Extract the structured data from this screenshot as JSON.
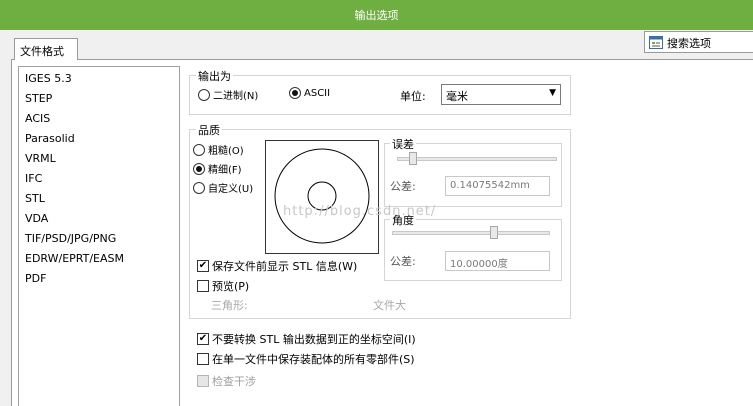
{
  "window": {
    "title": "输出选项"
  },
  "tab": {
    "label": "文件格式"
  },
  "search": {
    "label": "搜索选项",
    "icon": "search-options-icon"
  },
  "formats": [
    "IGES 5.3",
    "STEP",
    "ACIS",
    "Parasolid",
    "VRML",
    "IFC",
    "STL",
    "VDA",
    "TIF/PSD/JPG/PNG",
    "EDRW/EPRT/EASM",
    "PDF"
  ],
  "output_as": {
    "title": "输出为",
    "binary": {
      "label": "二进制(N)",
      "selected": false
    },
    "ascii": {
      "label": "ASCII",
      "selected": true
    },
    "unit_label": "单位:",
    "unit_value": "毫米"
  },
  "quality": {
    "title": "品质",
    "coarse": {
      "label": "粗糙(O)",
      "selected": false
    },
    "fine": {
      "label": "精细(F)",
      "selected": true
    },
    "custom": {
      "label": "自定义(U)",
      "selected": false
    }
  },
  "deviation": {
    "title": "误差",
    "tolerance_label": "公差:",
    "tolerance_value": "0.14075542mm",
    "slider_level": 0.08
  },
  "angle": {
    "title": "角度",
    "tolerance_label": "公差:",
    "tolerance_value": "10.00000度",
    "slider_level": 0.65
  },
  "show_stl_info": {
    "label": "保存文件前显示 STL 信息(W)",
    "checked": true
  },
  "preview": {
    "label": "预览(P)",
    "checked": false
  },
  "triangles_label": "三角形:",
  "file_size_label": "文件大",
  "no_translate": {
    "label": "不要转换 STL 输出数据到正的坐标空间(I)",
    "checked": true
  },
  "save_single": {
    "label": "在单一文件中保存装配体的所有零部件(S)",
    "checked": false
  },
  "check_interference": {
    "label": "检查干涉",
    "checked": false
  },
  "watermark": "http://blog.csdn.net/"
}
